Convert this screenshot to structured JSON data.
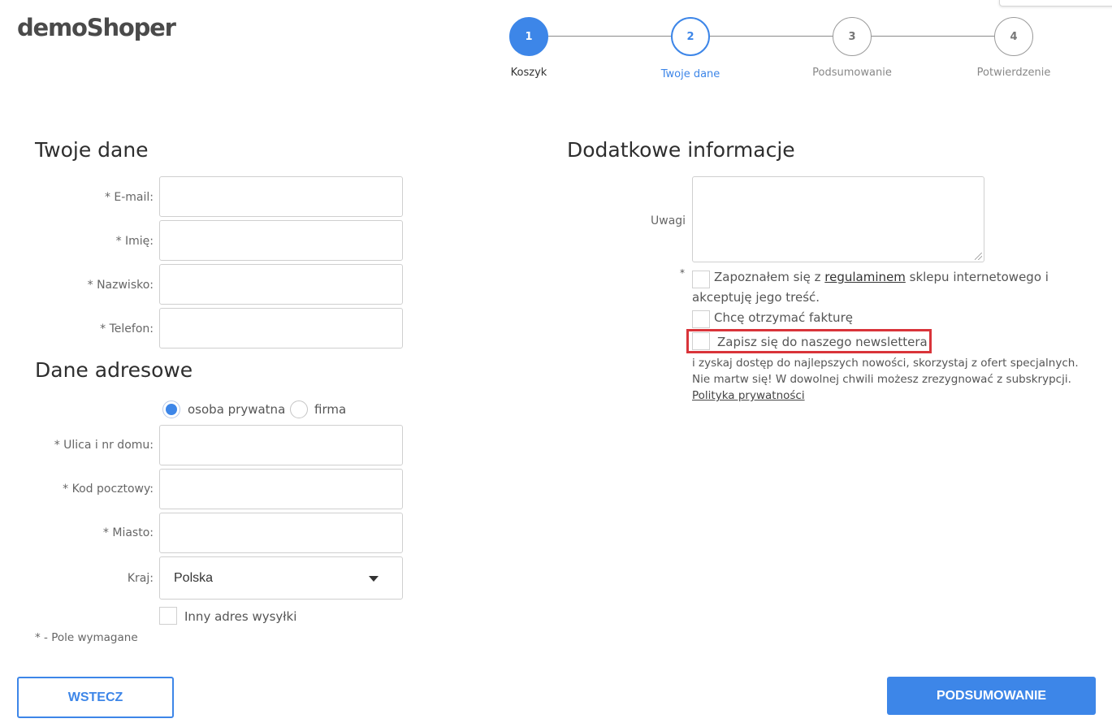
{
  "header": {
    "logo": "demoShoper"
  },
  "stepper": {
    "steps": [
      {
        "number": "1",
        "label": "Koszyk",
        "state": "done"
      },
      {
        "number": "2",
        "label": "Twoje dane",
        "state": "active"
      },
      {
        "number": "3",
        "label": "Podsumowanie",
        "state": "todo"
      },
      {
        "number": "4",
        "label": "Potwierdzenie",
        "state": "todo"
      }
    ]
  },
  "personal": {
    "title": "Twoje dane",
    "fields": [
      {
        "label": "* E-mail:",
        "value": ""
      },
      {
        "label": "* Imię:",
        "value": ""
      },
      {
        "label": "* Nazwisko:",
        "value": ""
      },
      {
        "label": "* Telefon:",
        "value": ""
      }
    ]
  },
  "address": {
    "title": "Dane adresowe",
    "type_options": [
      {
        "label": "osoba prywatna",
        "checked": true
      },
      {
        "label": "firma",
        "checked": false
      }
    ],
    "fields": [
      {
        "label": "* Ulica i nr domu:",
        "value": ""
      },
      {
        "label": "* Kod pocztowy:",
        "value": ""
      },
      {
        "label": "* Miasto:",
        "value": ""
      }
    ],
    "country_label": "Kraj:",
    "country_value": "Polska",
    "other_address_label": "Inny adres wysyłki",
    "required_note": "* - Pole wymagane"
  },
  "extra": {
    "title": "Dodatkowe informacje",
    "notes_label": "Uwagi",
    "notes_value": "",
    "terms_required_mark": "*",
    "terms_before": "Zapoznałem się z",
    "terms_link": "regulaminem",
    "terms_after": "sklepu internetowego i",
    "terms_line2": "akceptuję jego treść.",
    "invoice_label": "Chcę otrzymać fakturę",
    "newsletter_label": "Zapisz się do naszego newslettera",
    "newsletter_info_line1": "i zyskaj dostęp do najlepszych nowości, skorzystaj z ofert specjalnych.",
    "newsletter_info_line2": "Nie martw się! W dowolnej chwili możesz zrezygnować z subskrypcji.",
    "privacy_link": "Polityka prywatności"
  },
  "actions": {
    "back_label": "WSTECZ",
    "next_label": "PODSUMOWANIE"
  },
  "colors": {
    "accent": "#3d86e8",
    "highlight": "#d9343a"
  }
}
